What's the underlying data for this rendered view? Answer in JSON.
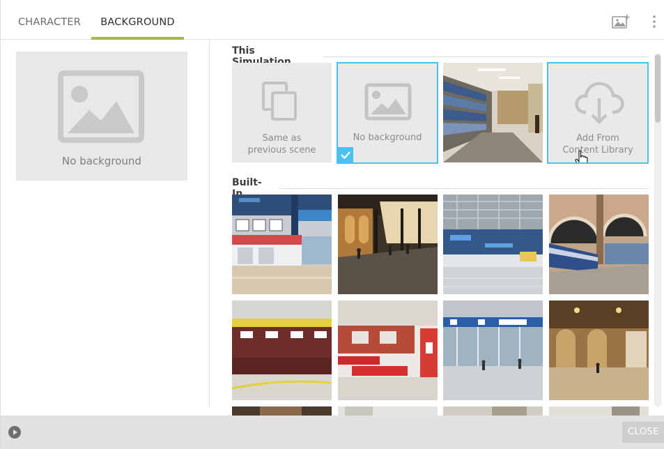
{
  "tabs": {
    "character": "CHARACTER",
    "background": "BACKGROUND",
    "active": "BACKGROUND"
  },
  "toolbar": {
    "add_image_icon": "add-image-icon",
    "more_icon": "vertical-dots-icon"
  },
  "preview": {
    "label": "No background",
    "icon": "image-placeholder-icon"
  },
  "sections": {
    "this_simulation": "This Simulation",
    "built_in": "Built-In"
  },
  "simulation_tiles": [
    {
      "line1": "Same as",
      "line2": "previous scene",
      "icon": "copy-icon"
    },
    {
      "label": "No background",
      "icon": "image-placeholder-icon",
      "selected": true
    },
    {
      "image": "library-bookshelves-photo"
    },
    {
      "line1": "Add From",
      "line2": "Content Library",
      "icon": "cloud-download-icon",
      "hover": true
    }
  ],
  "builtin_tiles": [
    {
      "image": "airport-checkin-counters-photo"
    },
    {
      "image": "train-station-arcade-photo"
    },
    {
      "image": "airport-terminal-hall-photo"
    },
    {
      "image": "train-station-platform-photo"
    },
    {
      "image": "ticket-counters-photo"
    },
    {
      "image": "waiting-area-red-chairs-photo"
    },
    {
      "image": "terminal-gates-photo"
    },
    {
      "image": "ornate-station-hall-photo"
    }
  ],
  "footer": {
    "close_label": "CLOSE",
    "play_icon": "play-icon"
  },
  "colors": {
    "accent_underline": "#a3b84e",
    "selection": "#4cc1ef",
    "tile_gray": "#e9e9e9",
    "footer": "#e2e2e2"
  }
}
